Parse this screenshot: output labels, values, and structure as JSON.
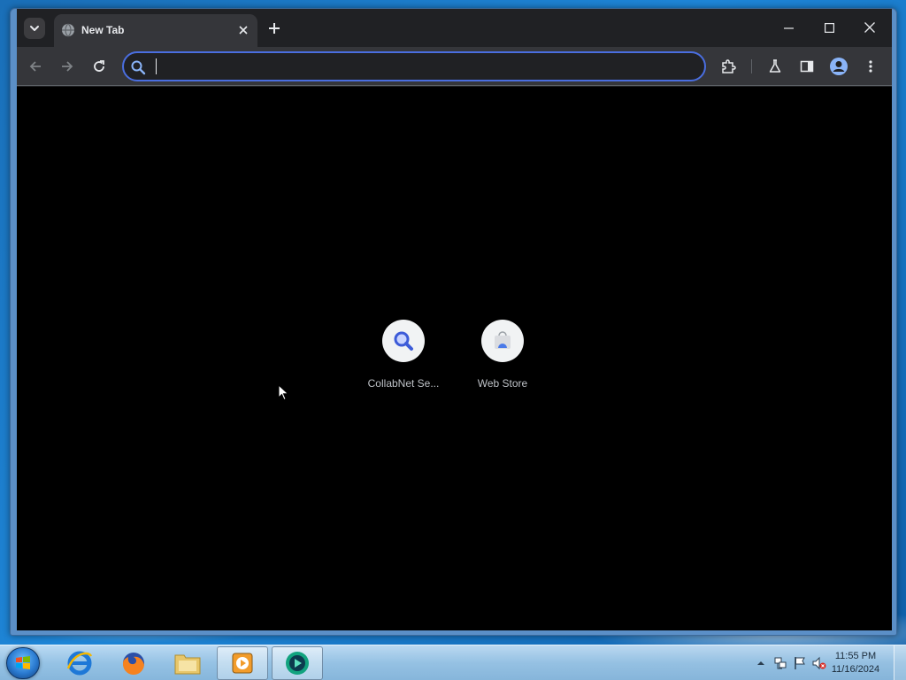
{
  "browser": {
    "tab": {
      "title": "New Tab",
      "favicon": "globe-icon"
    },
    "omnibox": {
      "value": "",
      "placeholder": ""
    },
    "accent_color": "#4a6ee0"
  },
  "new_tab_page": {
    "shortcuts": [
      {
        "label": "CollabNet Se...",
        "icon": "search-icon"
      },
      {
        "label": "Web Store",
        "icon": "web-store-icon"
      }
    ]
  },
  "taskbar": {
    "clock": {
      "time": "11:55 PM",
      "date": "11/16/2024"
    },
    "pinned": [
      "internet-explorer",
      "firefox",
      "windows-explorer",
      "media-player",
      "chrome-app"
    ]
  }
}
